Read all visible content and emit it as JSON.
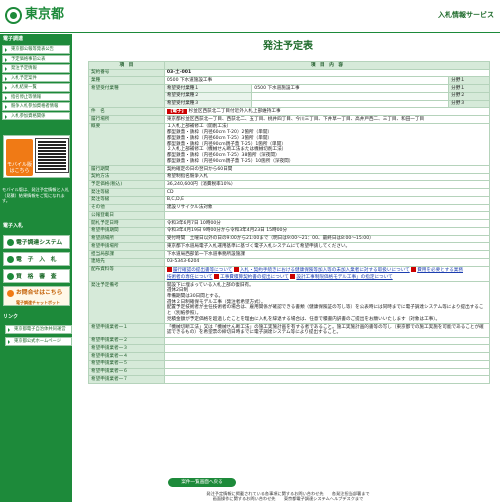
{
  "header": {
    "logo": "東京都",
    "service": "入札情報サービス"
  },
  "sidebar": {
    "section1": "電子調達",
    "items": [
      "東京都公報等発表公告",
      "予定価格事前公表",
      "発注予定情報",
      "入札予定案件",
      "入札結果一覧",
      "指名停止等情報",
      "競争入札参加資格者情報",
      "入札参加資格関係"
    ],
    "mobile_label": "モバイル版はこちら",
    "mobile_note": "モバイル版は、発注予定情報と入札（見積）結果情報をご覧になれます。",
    "section2": "電子入札",
    "sys": "電子調達システム(TOP)",
    "net": "電　子　入　札",
    "mat": "資　格　審　査",
    "inquiry_top": "お問合せはこちら",
    "inquiry_bottom": "電子調達チャットボット",
    "section3": "リンク",
    "links": [
      "東京都電子自治体共同運営",
      "東京都公式ホームページ"
    ]
  },
  "main": {
    "title": "発注予定表",
    "col_item": "項　目",
    "col_content": "項　目　内　容",
    "rows": {
      "contract_no_k": "契約番号",
      "contract_no": "03-土-001",
      "item_k": "業種",
      "item": "0500 下水道施設工事",
      "bid_k": "希望受付業種",
      "b1k": "希望受付業種１",
      "b1v": "0500 下水道施設工事",
      "b2k": "希望受付業種２",
      "b3k": "希望受付業種３",
      "div1": "分野１",
      "div2": "分野２",
      "div3": "分野３",
      "name_k": "件　名",
      "name_tag": "【電子】",
      "name": "杉並区西荻北二丁目付近外入札上部維持工事",
      "place_k": "履行場所",
      "place": "東京都杉並区西荻北一丁目、西荻北二、五丁目、桃井四丁目、今川三丁目、下井草一丁目、高井戸西二、三丁目、和田一丁目",
      "gaiyo_k": "概要",
      "gaiyo": [
        "１入札上部補修工（開削工法）",
        "都型鉄蓋・鉄枠（内径60cm T-20）2箇所（単開）",
        "都型鉄蓋・鉄枠（内径60cm T-25）3箇所（単開）",
        "都型鉄蓋・鉄枠（内径90cm親子蓋 T-25）1箇所（単開）",
        "２入札上部補修工（機械せん断工法または機械切削工法）",
        "都型鉄蓋・鉄枠（内径60cm T-25）38箇所（深夜間）",
        "都型鉄蓋・鉄枠（内径90cm親子蓋 T-25）10箇所（深夜間）"
      ],
      "period_k": "履行期間",
      "period": "契約確定の日の翌日から60日間",
      "method_k": "契約方法",
      "method": "希望制指名競争入札",
      "price_k": "予定価格(税込)",
      "price": "36,240,600円（消費税率10%）",
      "rank_k": "発注等級",
      "rank": "CD",
      "class_k": "発注等級",
      "class": "B,C,D,E",
      "other_k": "その他",
      "other": "建設リサイクル法対象",
      "dept_k": "公報登載日",
      "dept": "",
      "open_k": "開札予定日時",
      "open": "令和3年6月7日 10時00分",
      "apply_k": "希望申請期間",
      "apply": "令和3年4月19日 9時00分から令和3年4月23日 15時00分",
      "accept_k": "希望請場所",
      "accept": "受付時間　土曜日以外の日の9:00から21:00まで（明日は9:00～21：00、最終日は8:00～15:00）",
      "where_k": "希望申請場所",
      "where": "東京都下水道局電子入札運用基準に基づく電子入札システムにて希望申請してください。",
      "office_k": "担当局部課",
      "office": "下水道局西部第一下水道事務所設施課",
      "tel_k": "連絡先",
      "tel": "03-5343-6204",
      "docs_k": "配布資料等",
      "docs": [
        "履行確認の提出書等について",
        "入札・契約手続きにおける健康保険等加入等の未加入業者に対する取扱いについて",
        "費用を必要とする業務",
        "技術者の専任について",
        "工事費積算契約書の提出について",
        "設計工事制限価格モデル工事」の指定について"
      ],
      "note_k": "発注予定備考",
      "note": [
        "開設下に埋まっている入札上部の復旧有。",
        "週休2日制",
        "準備期間は30日間とする。",
        "週休２日制確保モデル工事（発注者希望方式）。",
        "配置予定技術者が主任技術者の場合は、雇用関係が確認できる書類（健康保険証の写し等）を公表時には同時までに電子調達システム等により提出すること（別紙参照）。",
        "見積金額が予定価格を超過したことを理由に入札を辞退する場合は、任意で積書内訳書のご提出をお願いいたします（対象は工事）。"
      ],
      "app_k": "希望申請業者一１",
      "app": "「機械切断工法」又は「機械せん断工法」の施工実施計画を有する者であること。施工実施計画的書等の写し（東京都での施工実施を可能であることが確認できるもの）を希望票の締切日時までに電子調達システム等により提出すること。",
      "app2": "希望申請業者一２",
      "app3": "希望申請業者一３",
      "app4": "希望申請業者一４",
      "app5": "希望申請業者一５",
      "app6": "希望申請業者一６",
      "app7": "希望申請業者一７"
    },
    "back": "案件一覧画面へ戻る"
  },
  "footer": {
    "l1": "発注予定情報に掲載されている各事項に関するお問い合わせ先　　各発注担当部署まで",
    "l2": "画面操作に関するお問い合わせ先　　東京都電子調達システムヘルプデスクまで"
  }
}
